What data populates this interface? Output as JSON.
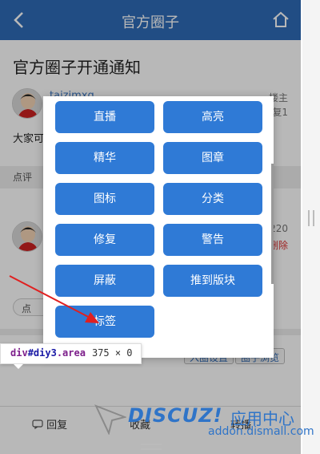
{
  "header": {
    "title": "官方圈子"
  },
  "thread": {
    "title": "官方圈子开通通知",
    "username": "taizimxq",
    "floor_label": "楼主",
    "reply_count_fragment": "复1",
    "body_fragment": "大家可"
  },
  "comment_bar": {
    "label": "点评"
  },
  "comment": {
    "time_fragment": "220",
    "delete_fragment": "删除",
    "reply_chip_fragment": "点"
  },
  "chips": {
    "left_fragment": "入圈设置",
    "right_fragment": "圈子浏览"
  },
  "bottom_bar": {
    "reply": "回复",
    "fav": "收藏",
    "share": "转播"
  },
  "modal": {
    "buttons": [
      "直播",
      "高亮",
      "精华",
      "图章",
      "图标",
      "分类",
      "修复",
      "警告",
      "屏蔽",
      "推到版块",
      "标签"
    ]
  },
  "tooltip": {
    "tag": "div",
    "id": "#diy3",
    "cls": ".area",
    "size": "375 × 0"
  },
  "watermark": {
    "logo": "DISCUZ!",
    "cn": "应用中心",
    "url": "addon.dismall.com"
  },
  "colors": {
    "header": "#2e6bb8",
    "button": "#2f7ad6",
    "accent": "#3a73bd",
    "danger": "#d33333",
    "arrow": "#e02020"
  }
}
